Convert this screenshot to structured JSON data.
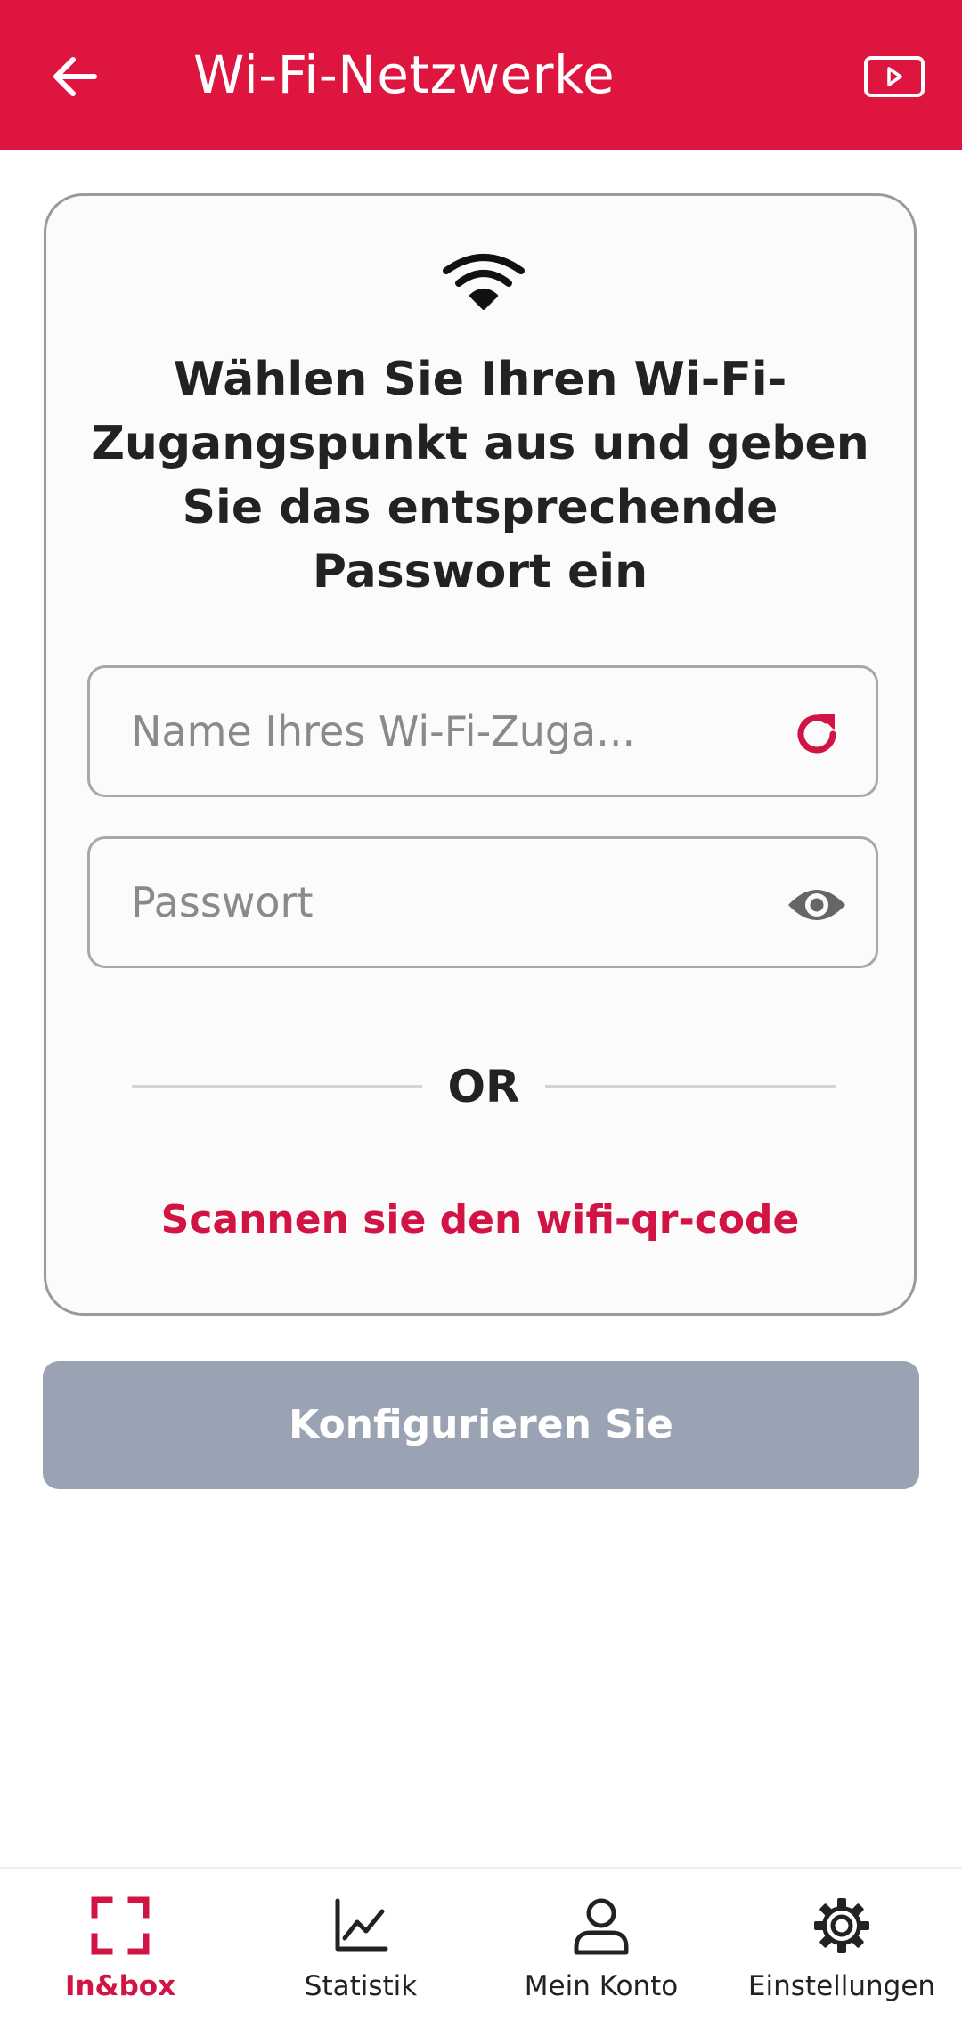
{
  "app_bar": {
    "title": "Wi-Fi-Netzwerke",
    "back_icon": "arrow-left-icon",
    "video_icon": "play-video-icon",
    "color": "#de163f"
  },
  "card": {
    "icon": "wifi-icon",
    "heading": "Wählen Sie Ihren Wi-Fi-Zugangspunkt aus und geben Sie das entsprechende Passwort ein",
    "ssid_field": {
      "value": "",
      "placeholder": "Name Ihres Wi-Fi-Zuga...",
      "icon": "refresh-icon"
    },
    "password_field": {
      "value": "",
      "placeholder": "Passwort",
      "icon": "eye-icon"
    },
    "divider_label": "OR",
    "scan_link": "Scannen sie den wifi-qr-code"
  },
  "configure_button": {
    "label": "Konfigurieren Sie",
    "color": "#99a3b4"
  },
  "bottom_nav": {
    "active_color": "#d11443",
    "items": [
      {
        "label": "In&box",
        "icon": "scan-frame-icon",
        "active": true
      },
      {
        "label": "Statistik",
        "icon": "chart-line-icon",
        "active": false
      },
      {
        "label": "Mein Konto",
        "icon": "user-icon",
        "active": false
      },
      {
        "label": "Einstellungen",
        "icon": "gear-icon",
        "active": false
      }
    ]
  }
}
